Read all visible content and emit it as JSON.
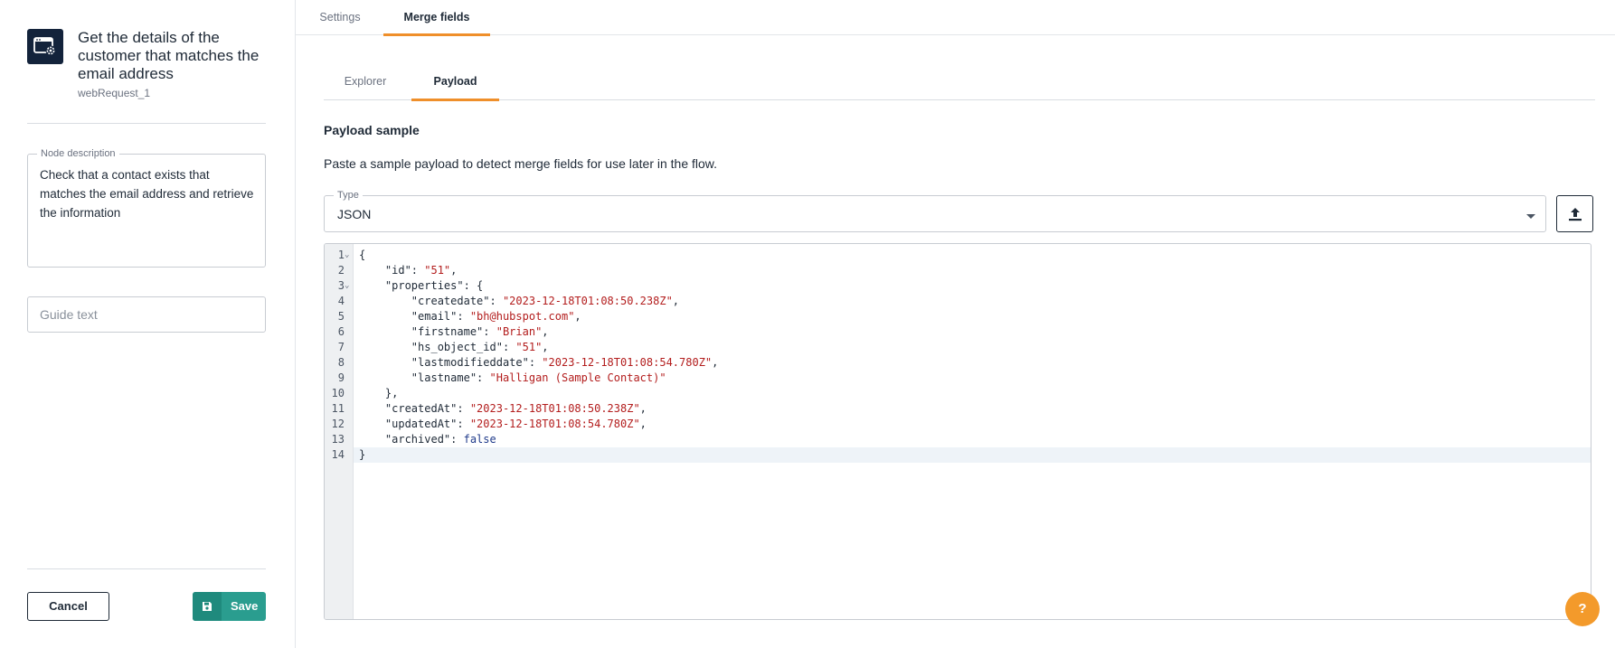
{
  "node": {
    "title": "Get the details of the customer that matches the email address",
    "subtitle": "webRequest_1",
    "icon": "web-request-settings-icon"
  },
  "description": {
    "label": "Node description",
    "value": "Check that a contact exists that matches the email address and retrieve the information"
  },
  "guide": {
    "placeholder": "Guide text",
    "value": ""
  },
  "actions": {
    "cancel_label": "Cancel",
    "save_label": "Save"
  },
  "tabs": {
    "settings": "Settings",
    "merge_fields": "Merge fields",
    "active": "merge_fields"
  },
  "subtabs": {
    "explorer": "Explorer",
    "payload": "Payload",
    "active": "payload"
  },
  "payload": {
    "title": "Payload sample",
    "description": "Paste a sample payload to detect merge fields for use later in the flow.",
    "type_label": "Type",
    "type_value": "JSON"
  },
  "code": {
    "current_line": 14,
    "lines": [
      {
        "n": "1",
        "fold": true,
        "parts": [
          {
            "t": "{",
            "c": "k"
          }
        ]
      },
      {
        "n": "2",
        "fold": false,
        "parts": [
          {
            "t": "    \"id\": ",
            "c": "k"
          },
          {
            "t": "\"51\"",
            "c": "s"
          },
          {
            "t": ",",
            "c": "k"
          }
        ]
      },
      {
        "n": "3",
        "fold": true,
        "parts": [
          {
            "t": "    \"properties\": {",
            "c": "k"
          }
        ]
      },
      {
        "n": "4",
        "fold": false,
        "parts": [
          {
            "t": "        \"createdate\": ",
            "c": "k"
          },
          {
            "t": "\"2023-12-18T01:08:50.238Z\"",
            "c": "s"
          },
          {
            "t": ",",
            "c": "k"
          }
        ]
      },
      {
        "n": "5",
        "fold": false,
        "parts": [
          {
            "t": "        \"email\": ",
            "c": "k"
          },
          {
            "t": "\"bh@hubspot.com\"",
            "c": "s"
          },
          {
            "t": ",",
            "c": "k"
          }
        ]
      },
      {
        "n": "6",
        "fold": false,
        "parts": [
          {
            "t": "        \"firstname\": ",
            "c": "k"
          },
          {
            "t": "\"Brian\"",
            "c": "s"
          },
          {
            "t": ",",
            "c": "k"
          }
        ]
      },
      {
        "n": "7",
        "fold": false,
        "parts": [
          {
            "t": "        \"hs_object_id\": ",
            "c": "k"
          },
          {
            "t": "\"51\"",
            "c": "s"
          },
          {
            "t": ",",
            "c": "k"
          }
        ]
      },
      {
        "n": "8",
        "fold": false,
        "parts": [
          {
            "t": "        \"lastmodifieddate\": ",
            "c": "k"
          },
          {
            "t": "\"2023-12-18T01:08:54.780Z\"",
            "c": "s"
          },
          {
            "t": ",",
            "c": "k"
          }
        ]
      },
      {
        "n": "9",
        "fold": false,
        "parts": [
          {
            "t": "        \"lastname\": ",
            "c": "k"
          },
          {
            "t": "\"Halligan (Sample Contact)\"",
            "c": "s"
          }
        ]
      },
      {
        "n": "10",
        "fold": false,
        "parts": [
          {
            "t": "    },",
            "c": "k"
          }
        ]
      },
      {
        "n": "11",
        "fold": false,
        "parts": [
          {
            "t": "    \"createdAt\": ",
            "c": "k"
          },
          {
            "t": "\"2023-12-18T01:08:50.238Z\"",
            "c": "s"
          },
          {
            "t": ",",
            "c": "k"
          }
        ]
      },
      {
        "n": "12",
        "fold": false,
        "parts": [
          {
            "t": "    \"updatedAt\": ",
            "c": "k"
          },
          {
            "t": "\"2023-12-18T01:08:54.780Z\"",
            "c": "s"
          },
          {
            "t": ",",
            "c": "k"
          }
        ]
      },
      {
        "n": "13",
        "fold": false,
        "parts": [
          {
            "t": "    \"archived\": ",
            "c": "k"
          },
          {
            "t": "false",
            "c": "b"
          }
        ]
      },
      {
        "n": "14",
        "fold": false,
        "parts": [
          {
            "t": "}",
            "c": "k"
          }
        ]
      }
    ]
  },
  "help": {
    "label": "?"
  },
  "colors": {
    "accent": "#ef8f2a",
    "save": "#2a9d8f",
    "node_icon_bg": "#13233b",
    "string": "#b31d1d",
    "boolean": "#1f3a8a"
  }
}
